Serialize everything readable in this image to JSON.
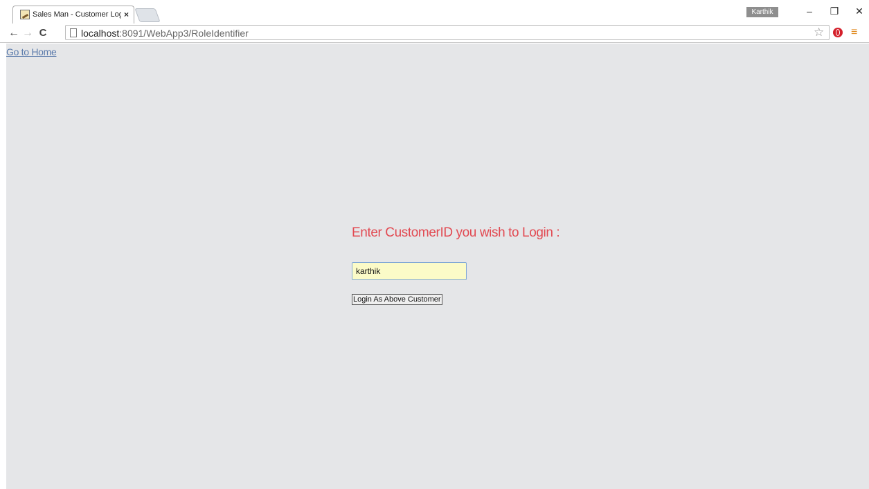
{
  "browser": {
    "tab_title": "Sales Man - Customer Log",
    "tab_close": "×",
    "profile_name": "Karthik",
    "window_controls": {
      "minimize": "–",
      "restore": "❐",
      "close": "✕"
    },
    "nav": {
      "back": "←",
      "forward": "→",
      "reload": "C"
    },
    "address": {
      "host": "localhost",
      "rest": ":8091/WebApp3/RoleIdentifier"
    },
    "icons": {
      "bookmark": "star-icon",
      "extension": "opera-icon",
      "menu": "hamburger-menu-icon"
    },
    "star_glyph": "☆",
    "menu_glyph": "≡"
  },
  "page": {
    "home_link": "Go to Home",
    "heading": "Enter CustomerID you wish to Login :",
    "customer_id_value": "karthik",
    "login_button": "Login As Above Customer",
    "colors": {
      "heading": "#e24a52",
      "background": "#e5e6e8",
      "input_bg": "#fbfbc8",
      "link": "#5a7aab"
    }
  }
}
